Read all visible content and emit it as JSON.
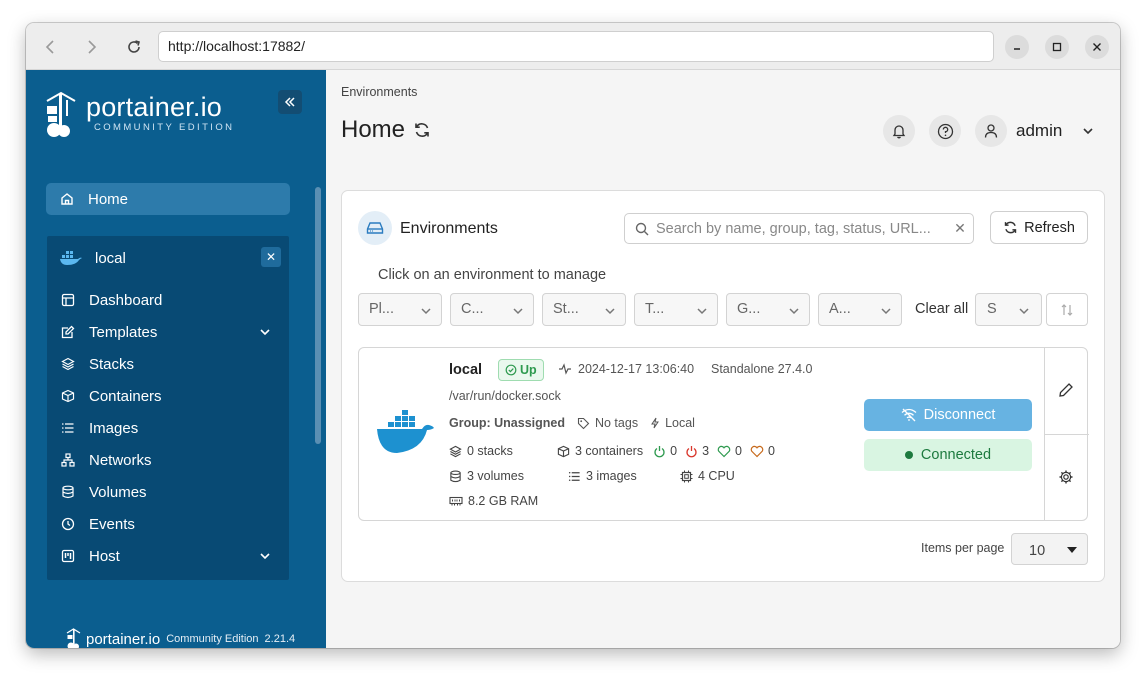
{
  "browser": {
    "url": "http://localhost:17882/"
  },
  "sidebar": {
    "logo_text": "portainer.io",
    "logo_subtitle": "COMMUNITY EDITION",
    "home_label": "Home",
    "environment": {
      "name": "local",
      "items": [
        {
          "label": "Dashboard",
          "icon": "dashboard-icon"
        },
        {
          "label": "Templates",
          "icon": "templates-icon"
        },
        {
          "label": "Stacks",
          "icon": "stacks-icon"
        },
        {
          "label": "Containers",
          "icon": "containers-icon"
        },
        {
          "label": "Images",
          "icon": "images-icon"
        },
        {
          "label": "Networks",
          "icon": "networks-icon"
        },
        {
          "label": "Volumes",
          "icon": "volumes-icon"
        },
        {
          "label": "Events",
          "icon": "events-icon"
        },
        {
          "label": "Host",
          "icon": "host-icon"
        }
      ]
    },
    "footer": {
      "brand": "portainer.io",
      "edition": "Community Edition",
      "version": "2.21.4"
    }
  },
  "header": {
    "breadcrumb": "Environments",
    "title": "Home",
    "user": "admin"
  },
  "card": {
    "title": "Environments",
    "search_placeholder": "Search by name, group, tag, status, URL...",
    "refresh_label": "Refresh",
    "hint": "Click on an environment to manage",
    "filters": [
      "Pl...",
      "C...",
      "St...",
      "T...",
      "G...",
      "A..."
    ],
    "clear_all": "Clear all",
    "sort_value": "S"
  },
  "environment_item": {
    "name": "local",
    "status": "Up",
    "heartbeat": "2024-12-17 13:06:40",
    "type": "Standalone 27.4.0",
    "url": "/var/run/docker.sock",
    "group": "Group: Unassigned",
    "tags": "No tags",
    "location": "Local",
    "stacks": "0 stacks",
    "containers": "3 containers",
    "running": "0",
    "stopped": "3",
    "healthy": "0",
    "unhealthy": "0",
    "volumes": "3 volumes",
    "images": "3 images",
    "cpu": "4 CPU",
    "ram": "8.2 GB RAM",
    "disconnect_label": "Disconnect",
    "connected_label": "Connected"
  },
  "pagination": {
    "label": "Items per page",
    "value": "10"
  },
  "colors": {
    "sidebar_bg": "#0b5e8f",
    "env_panel_bg": "#084a74",
    "accent": "#2d7bab",
    "up_green": "#2e9a4f",
    "stopped_red": "#d9362b",
    "unhealthy_orange": "#c76a1c"
  }
}
